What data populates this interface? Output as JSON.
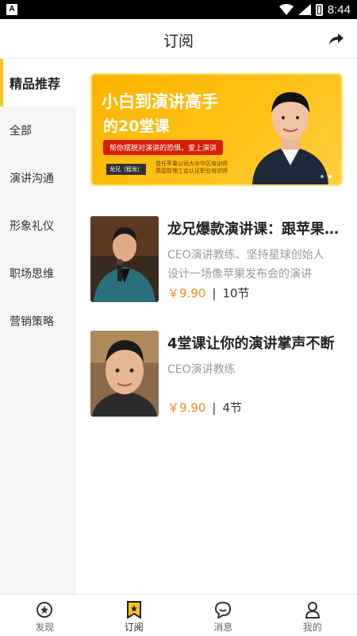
{
  "status_bar": {
    "left_badge": "A",
    "time": "8:44"
  },
  "header": {
    "title": "订阅"
  },
  "sidebar": {
    "items": [
      {
        "label": "精品推荐",
        "active": true
      },
      {
        "label": "全部"
      },
      {
        "label": "演讲沟通"
      },
      {
        "label": "形象礼仪"
      },
      {
        "label": "职场思维"
      },
      {
        "label": "营销策略"
      }
    ]
  },
  "banner": {
    "title_line1": "小白到演讲高手",
    "title_line2": "的20堂课",
    "tagline": "帮你摆脱对演讲的恐惧，爱上演讲",
    "speaker": "龙兄（程龙）",
    "credit_line1": "曾任苹果公司大中华区培训师",
    "credit_line2": "英国管理工会认证职业培训师"
  },
  "courses": [
    {
      "title": "龙兄爆款演讲课：跟苹果培训师学演讲",
      "subtitle": "CEO演讲教练、坚持星球创始人",
      "description": "设计一场像苹果发布会的演讲",
      "price": "￥9.90",
      "separator": "|",
      "lessons": "10节"
    },
    {
      "title": "4堂课让你的演讲掌声不断",
      "subtitle": "CEO演讲教练",
      "description": "",
      "price": "￥9.90",
      "separator": "|",
      "lessons": "4节"
    }
  ],
  "tabbar": {
    "items": [
      {
        "label": "发现",
        "icon": "discover-icon"
      },
      {
        "label": "订阅",
        "icon": "subscribe-icon",
        "active": true
      },
      {
        "label": "消息",
        "icon": "message-icon"
      },
      {
        "label": "我的",
        "icon": "profile-icon"
      }
    ]
  },
  "colors": {
    "accent": "#ffc21a",
    "price": "#f28a1a",
    "banner_tag": "#d81e06"
  }
}
